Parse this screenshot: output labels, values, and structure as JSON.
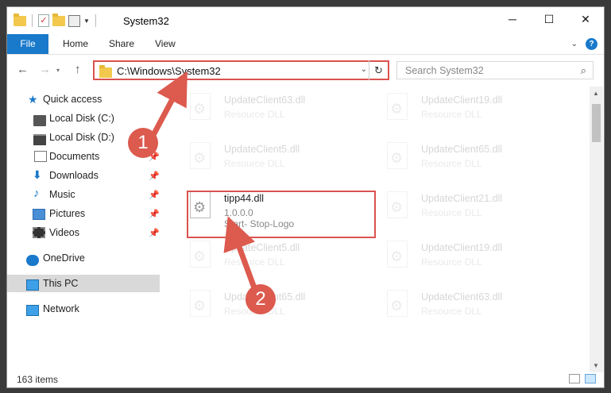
{
  "window": {
    "title": "System32",
    "controls": {
      "minimize": "─",
      "maximize": "☐",
      "close": "✕"
    }
  },
  "ribbon": {
    "tabs": [
      {
        "label": "File"
      },
      {
        "label": "Home"
      },
      {
        "label": "Share"
      },
      {
        "label": "View"
      }
    ],
    "expand_icon": "chevron-down-icon",
    "help_label": "?"
  },
  "navigation": {
    "address": "C:\\Windows\\System32",
    "search_placeholder": "Search System32"
  },
  "sidebar": {
    "items": [
      {
        "label": "Quick access",
        "icon": "star-icon"
      },
      {
        "label": "Local Disk (C:)",
        "icon": "drive-icon"
      },
      {
        "label": "Local Disk (D:)",
        "icon": "drive-icon"
      },
      {
        "label": "Documents",
        "icon": "documents-icon",
        "pinned": true
      },
      {
        "label": "Downloads",
        "icon": "downloads-icon",
        "pinned": true
      },
      {
        "label": "Music",
        "icon": "music-icon",
        "pinned": true
      },
      {
        "label": "Pictures",
        "icon": "pictures-icon",
        "pinned": true
      },
      {
        "label": "Videos",
        "icon": "videos-icon",
        "pinned": true
      },
      {
        "label": "OneDrive",
        "icon": "onedrive-icon"
      },
      {
        "label": "This PC",
        "icon": "this-pc-icon",
        "selected": true
      },
      {
        "label": "Network",
        "icon": "network-icon"
      }
    ]
  },
  "files": {
    "left": [
      {
        "name": "UpdateClient63.dll",
        "desc": "Resource DLL"
      },
      {
        "name": "UpdateClient5.dll",
        "desc": "Resource DLL"
      },
      {
        "name": "tipp44.dll",
        "version": "1.0.0.0",
        "desc": "Start- Stop-Logo",
        "highlighted": true
      },
      {
        "name": "UpdateClient5.dll",
        "desc": "Resource DLL"
      },
      {
        "name": "UpdateClient65.dll",
        "desc": "Resource DLL"
      }
    ],
    "right": [
      {
        "name": "UpdateClient19.dll",
        "desc": "Resource DLL"
      },
      {
        "name": "UpdateClient65.dll",
        "desc": "Resource DLL"
      },
      {
        "name": "UpdateClient21.dll",
        "desc": "Resource DLL"
      },
      {
        "name": "UpdateClient19.dll",
        "desc": "Resource DLL"
      },
      {
        "name": "UpdateClient63.dll",
        "desc": "Resource DLL"
      }
    ]
  },
  "status": {
    "item_count": "163 items"
  },
  "callouts": [
    {
      "number": "1"
    },
    {
      "number": "2"
    }
  ],
  "colors": {
    "accent": "#1979ca",
    "highlight_border": "#d9534f",
    "callout": "#dc5a4e",
    "selected_nav": "#d9d9d9"
  }
}
